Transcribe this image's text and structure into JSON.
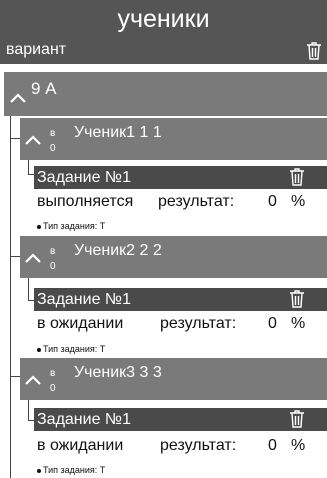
{
  "header": {
    "title": "ученики",
    "variant_label": "вариант"
  },
  "group": {
    "name": "9 А"
  },
  "students": [
    {
      "badge_top": "в",
      "badge_bottom": "0",
      "name": "Ученик1 1 1",
      "task": {
        "name": "Задание №1",
        "status": "выполняется",
        "result_label": "результат:",
        "result_value": "0",
        "percent": "%",
        "type_text": "Тип задания: Т"
      }
    },
    {
      "badge_top": "в",
      "badge_bottom": "0",
      "name": "Ученик2 2 2",
      "task": {
        "name": "Задание №1",
        "status": "в ожидании",
        "result_label": "результат:",
        "result_value": "0",
        "percent": "%",
        "type_text": "Тип задания: Т"
      }
    },
    {
      "badge_top": "в",
      "badge_bottom": "0",
      "name": "Ученик3 3 3",
      "task": {
        "name": "Задание №1",
        "status": "в ожидании",
        "result_label": "результат:",
        "result_value": "0",
        "percent": "%",
        "type_text": "Тип задания: Т"
      }
    }
  ],
  "colors": {
    "header_bg": "#555555",
    "bar_bg": "#7a7a7a",
    "task_bg": "#4a4a4a"
  },
  "icons": {
    "delete": "trash-icon",
    "expand": "chevron-up-icon"
  }
}
